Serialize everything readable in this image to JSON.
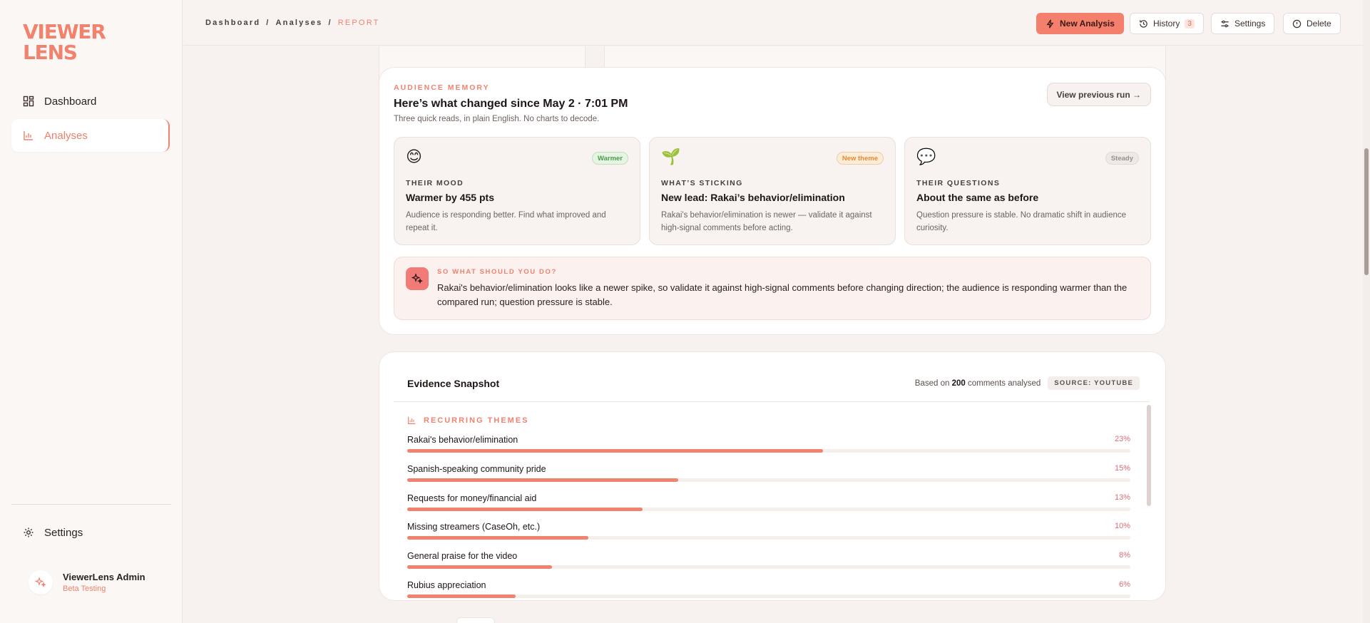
{
  "app": {
    "logo_line1": "VIEWER",
    "logo_line2": "LENS"
  },
  "sidebar": {
    "items": [
      {
        "label": "Dashboard",
        "icon": "grid-icon"
      },
      {
        "label": "Analyses",
        "icon": "bar-chart-icon"
      }
    ],
    "settings_label": "Settings",
    "user": {
      "name": "ViewerLens Admin",
      "role": "Beta Testing"
    }
  },
  "header": {
    "breadcrumb": [
      "Dashboard",
      "Analyses",
      "REPORT"
    ],
    "separator": "/",
    "new_analysis": "New Analysis",
    "history": "History",
    "history_count": "3",
    "settings": "Settings",
    "delete": "Delete"
  },
  "audience": {
    "eyebrow": "AUDIENCE MEMORY",
    "title": "Here’s what changed since May 2 · 7:01 PM",
    "subtitle": "Three quick reads, in plain English. No charts to decode.",
    "prev_button": "View previous run →",
    "cards": [
      {
        "emoji": "😊",
        "pill": "Warmer",
        "label": "THEIR MOOD",
        "headline": "Warmer by 455 pts",
        "body": "Audience is responding better. Find what improved and repeat it."
      },
      {
        "emoji": "🌱",
        "pill": "New theme",
        "label": "WHAT’S STICKING",
        "headline": "New lead: Rakai’s behavior/elimination",
        "body": "Rakai's behavior/elimination is newer — validate it against high-signal comments before acting."
      },
      {
        "emoji": "💬",
        "pill": "Steady",
        "label": "THEIR QUESTIONS",
        "headline": "About the same as before",
        "body": "Question pressure is stable. No dramatic shift in audience curiosity."
      }
    ],
    "so_what": {
      "eyebrow": "SO WHAT SHOULD YOU DO?",
      "text": "Rakai's behavior/elimination looks like a newer spike, so validate it against high-signal comments before changing direction; the audience is responding warmer than the compared run; question pressure is stable."
    }
  },
  "evidence": {
    "title": "Evidence Snapshot",
    "meta_prefix": "Based on",
    "meta_count": "200",
    "meta_suffix": "comments analysed",
    "source": "SOURCE: YOUTUBE",
    "themes_heading": "RECURRING THEMES",
    "themes": [
      {
        "name": "Rakai's behavior/elimination",
        "pct_label": "23%",
        "bar_fill": 0.575
      },
      {
        "name": "Spanish-speaking community pride",
        "pct_label": "15%",
        "bar_fill": 0.375
      },
      {
        "name": "Requests for money/financial aid",
        "pct_label": "13%",
        "bar_fill": 0.325
      },
      {
        "name": "Missing streamers (CaseOh, etc.)",
        "pct_label": "10%",
        "bar_fill": 0.25
      },
      {
        "name": "General praise for the video",
        "pct_label": "8%",
        "bar_fill": 0.2
      },
      {
        "name": "Rubius appreciation",
        "pct_label": "6%",
        "bar_fill": 0.15
      }
    ]
  },
  "colors": {
    "accent": "#f0826e",
    "pct_text": "#e06a74",
    "background": "#f7f2ef"
  }
}
